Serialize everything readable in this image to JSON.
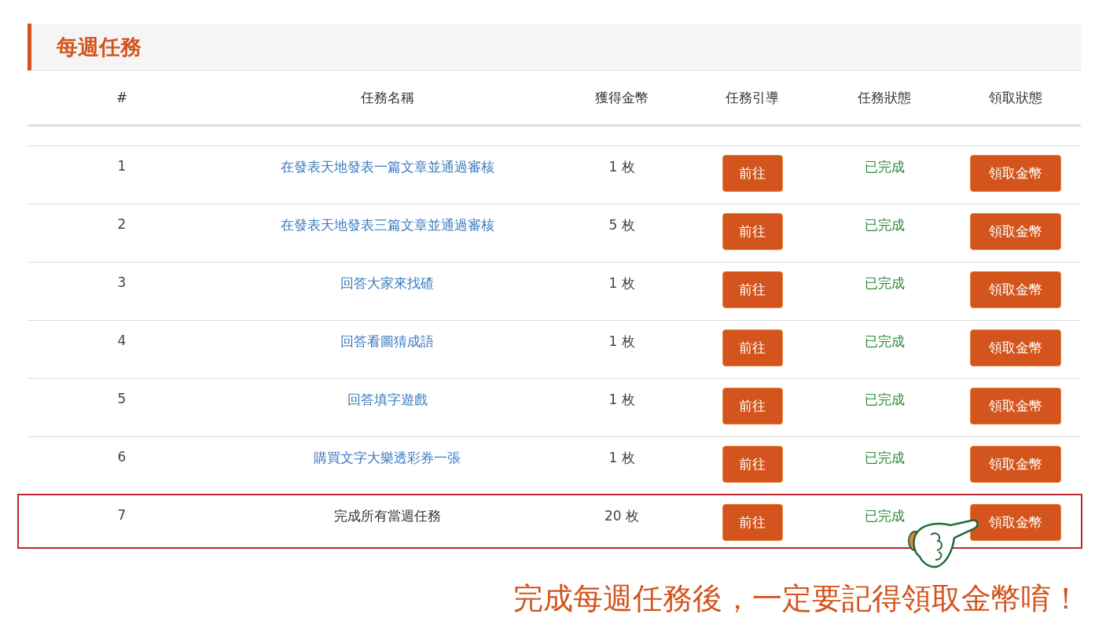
{
  "section_title": "每週任務",
  "columns": [
    "#",
    "任務名稱",
    "獲得金幣",
    "任務引導",
    "任務狀態",
    "領取狀態"
  ],
  "rows": [
    {
      "index": "1",
      "name": "在發表天地發表一篇文章並通過審核",
      "kind": "link",
      "coins": "1 枚",
      "go": "前往",
      "status": "已完成",
      "completed": true,
      "claim": "領取金幣",
      "highlighted": false
    },
    {
      "index": "2",
      "name": "在發表天地發表三篇文章並通過審核",
      "kind": "link",
      "coins": "5 枚",
      "go": "前往",
      "status": "已完成",
      "completed": true,
      "claim": "領取金幣",
      "highlighted": false
    },
    {
      "index": "3",
      "name": "回答大家來找碴",
      "kind": "link",
      "coins": "1 枚",
      "go": "前往",
      "status": "已完成",
      "completed": true,
      "claim": "領取金幣",
      "highlighted": false
    },
    {
      "index": "4",
      "name": "回答看圖猜成語",
      "kind": "link",
      "coins": "1 枚",
      "go": "前往",
      "status": "已完成",
      "completed": true,
      "claim": "領取金幣",
      "highlighted": false
    },
    {
      "index": "5",
      "name": "回答填字遊戲",
      "kind": "link",
      "coins": "1 枚",
      "go": "前往",
      "status": "已完成",
      "completed": true,
      "claim": "領取金幣",
      "highlighted": false
    },
    {
      "index": "6",
      "name": "購買文字大樂透彩券一張",
      "kind": "link",
      "coins": "1 枚",
      "go": "前往",
      "status": "已完成",
      "completed": true,
      "claim": "領取金幣",
      "highlighted": false
    },
    {
      "index": "7",
      "name": "完成所有當週任務",
      "kind": "plain",
      "coins": "20 枚",
      "go": "前往",
      "status": "已完成",
      "completed": true,
      "claim": "領取金幣",
      "highlighted": true
    }
  ],
  "caption": "完成每週任務後，一定要記得領取金幣唷！"
}
